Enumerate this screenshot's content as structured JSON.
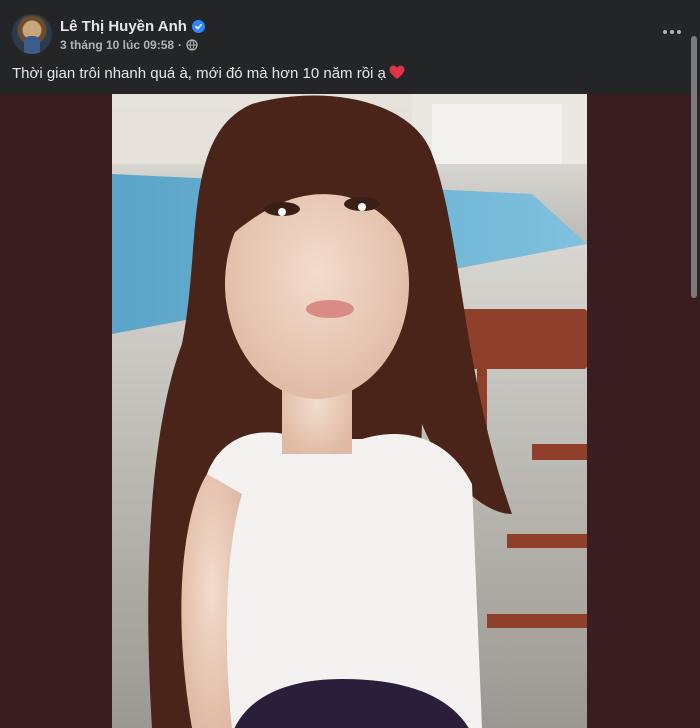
{
  "post": {
    "author_name": "Lê Thị Huyền Anh",
    "timestamp": "3 tháng 10 lúc 09:58",
    "separator": "·",
    "privacy_icon": "globe-icon",
    "verified_icon": "verified-badge-icon",
    "caption": "Thời gian trôi nhanh quá à, mới đó mà hơn 10 năm rồi ạ",
    "caption_emoji": "heart-icon",
    "more_icon": "more-options-icon"
  },
  "colors": {
    "header_bg": "#242526",
    "page_bg": "#3a1d21",
    "primary_text": "#e4e6eb",
    "secondary_text": "#b0b3b8",
    "verified_blue": "#2d88ff",
    "heart_red": "#e0334a"
  }
}
